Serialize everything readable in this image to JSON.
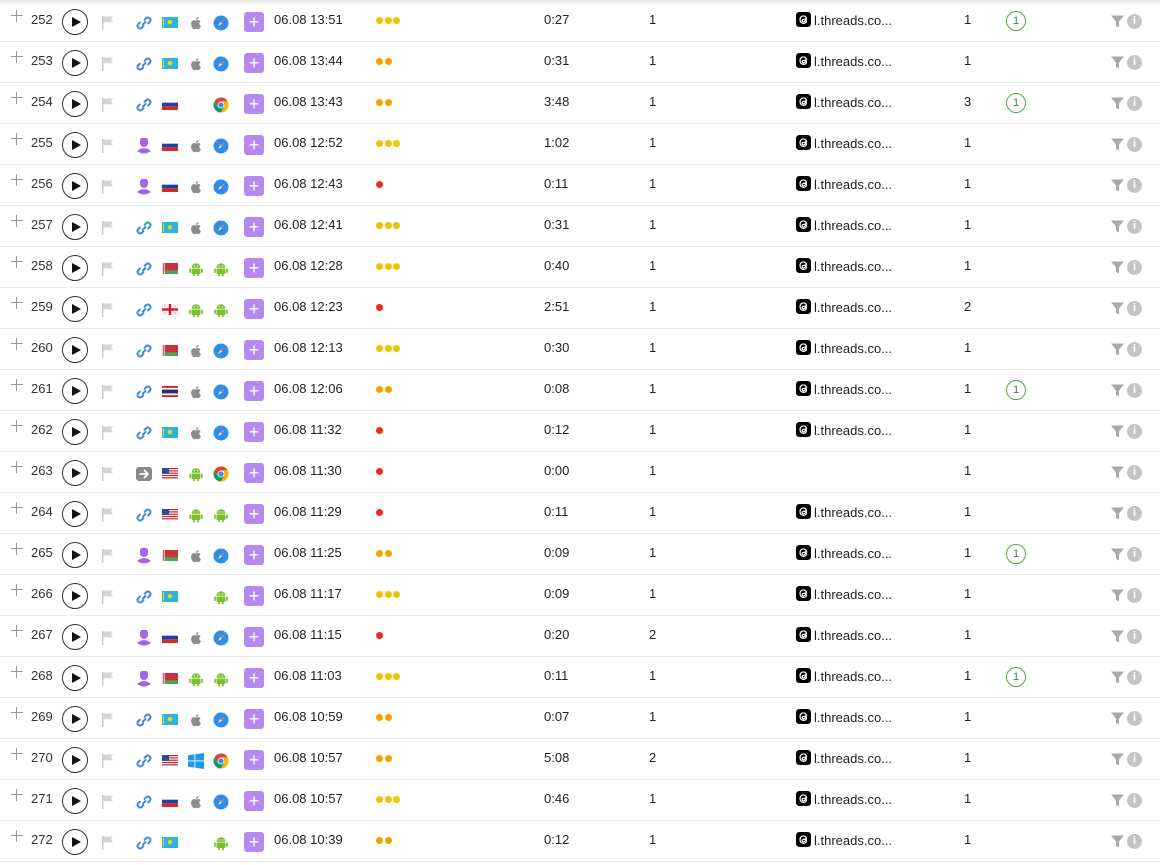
{
  "colors": {
    "accent_purple": "#b58af0",
    "dot_yellow": "#f2c200",
    "dot_orange": "#f5a000",
    "dot_red": "#ee2a1a",
    "badge_green": "#4aaa4a",
    "link_blue": "#3b8bd8"
  },
  "info_icon_text": "i",
  "add_icon_text": "+",
  "rows": [
    {
      "num": "252",
      "source": "link-icon",
      "country": "kz",
      "os": "apple-icon",
      "browser": "safari-icon",
      "date": "06.08 13:51",
      "quality": 3,
      "duration": "0:27",
      "views": "1",
      "referrer": "l.threads.co...",
      "count": "1",
      "badge": "1"
    },
    {
      "num": "253",
      "source": "link-icon",
      "country": "kz",
      "os": "apple-icon",
      "browser": "safari-icon",
      "date": "06.08 13:44",
      "quality": 2,
      "duration": "0:31",
      "views": "1",
      "referrer": "l.threads.co...",
      "count": "1",
      "badge": ""
    },
    {
      "num": "254",
      "source": "link-icon",
      "country": "ru",
      "os": "",
      "browser": "chrome-icon",
      "date": "06.08 13:43",
      "quality": 2,
      "duration": "3:48",
      "views": "1",
      "referrer": "l.threads.co...",
      "count": "3",
      "badge": "1"
    },
    {
      "num": "255",
      "source": "user-icon",
      "country": "ru",
      "os": "apple-icon",
      "browser": "safari-icon",
      "date": "06.08 12:52",
      "quality": 3,
      "duration": "1:02",
      "views": "1",
      "referrer": "l.threads.co...",
      "count": "1",
      "badge": ""
    },
    {
      "num": "256",
      "source": "user-icon",
      "country": "ru",
      "os": "apple-icon",
      "browser": "safari-icon",
      "date": "06.08 12:43",
      "quality": 1,
      "duration": "0:11",
      "views": "1",
      "referrer": "l.threads.co...",
      "count": "1",
      "badge": ""
    },
    {
      "num": "257",
      "source": "link-icon",
      "country": "kz",
      "os": "apple-icon",
      "browser": "safari-icon",
      "date": "06.08 12:41",
      "quality": 3,
      "duration": "0:31",
      "views": "1",
      "referrer": "l.threads.co...",
      "count": "1",
      "badge": ""
    },
    {
      "num": "258",
      "source": "link-icon",
      "country": "by",
      "os": "android-icon",
      "browser": "android-icon",
      "date": "06.08 12:28",
      "quality": 3,
      "duration": "0:40",
      "views": "1",
      "referrer": "l.threads.co...",
      "count": "1",
      "badge": ""
    },
    {
      "num": "259",
      "source": "link-icon",
      "country": "ge",
      "os": "android-icon",
      "browser": "android-icon",
      "date": "06.08 12:23",
      "quality": 1,
      "duration": "2:51",
      "views": "1",
      "referrer": "l.threads.co...",
      "count": "2",
      "badge": ""
    },
    {
      "num": "260",
      "source": "link-icon",
      "country": "by",
      "os": "apple-icon",
      "browser": "safari-icon",
      "date": "06.08 12:13",
      "quality": 3,
      "duration": "0:30",
      "views": "1",
      "referrer": "l.threads.co...",
      "count": "1",
      "badge": ""
    },
    {
      "num": "261",
      "source": "link-icon",
      "country": "th",
      "os": "apple-icon",
      "browser": "safari-icon",
      "date": "06.08 12:06",
      "quality": 2,
      "duration": "0:08",
      "views": "1",
      "referrer": "l.threads.co...",
      "count": "1",
      "badge": "1"
    },
    {
      "num": "262",
      "source": "link-icon",
      "country": "kz",
      "os": "apple-icon",
      "browser": "safari-icon",
      "date": "06.08 11:32",
      "quality": 1,
      "duration": "0:12",
      "views": "1",
      "referrer": "l.threads.co...",
      "count": "1",
      "badge": ""
    },
    {
      "num": "263",
      "source": "arrow-icon",
      "country": "us",
      "os": "android-icon",
      "browser": "chrome-icon",
      "date": "06.08 11:30",
      "quality": 1,
      "duration": "0:00",
      "views": "1",
      "referrer": "",
      "count": "1",
      "badge": ""
    },
    {
      "num": "264",
      "source": "link-icon",
      "country": "us",
      "os": "android-icon",
      "browser": "android-icon",
      "date": "06.08 11:29",
      "quality": 1,
      "duration": "0:11",
      "views": "1",
      "referrer": "l.threads.co...",
      "count": "1",
      "badge": ""
    },
    {
      "num": "265",
      "source": "user-icon",
      "country": "by",
      "os": "apple-icon",
      "browser": "safari-icon",
      "date": "06.08 11:25",
      "quality": 2,
      "duration": "0:09",
      "views": "1",
      "referrer": "l.threads.co...",
      "count": "1",
      "badge": "1"
    },
    {
      "num": "266",
      "source": "link-icon",
      "country": "kz",
      "os": "",
      "browser": "android-icon",
      "date": "06.08 11:17",
      "quality": 3,
      "duration": "0:09",
      "views": "1",
      "referrer": "l.threads.co...",
      "count": "1",
      "badge": ""
    },
    {
      "num": "267",
      "source": "user-icon",
      "country": "ru",
      "os": "apple-icon",
      "browser": "safari-icon",
      "date": "06.08 11:15",
      "quality": 1,
      "duration": "0:20",
      "views": "2",
      "referrer": "l.threads.co...",
      "count": "1",
      "badge": ""
    },
    {
      "num": "268",
      "source": "user-icon",
      "country": "by",
      "os": "android-icon",
      "browser": "android-icon",
      "date": "06.08 11:03",
      "quality": 3,
      "duration": "0:11",
      "views": "1",
      "referrer": "l.threads.co...",
      "count": "1",
      "badge": "1"
    },
    {
      "num": "269",
      "source": "link-icon",
      "country": "kz",
      "os": "apple-icon",
      "browser": "safari-icon",
      "date": "06.08 10:59",
      "quality": 2,
      "duration": "0:07",
      "views": "1",
      "referrer": "l.threads.co...",
      "count": "1",
      "badge": ""
    },
    {
      "num": "270",
      "source": "link-icon",
      "country": "us",
      "os": "windows-icon",
      "browser": "chrome-icon",
      "date": "06.08 10:57",
      "quality": 2,
      "duration": "5:08",
      "views": "2",
      "referrer": "l.threads.co...",
      "count": "1",
      "badge": ""
    },
    {
      "num": "271",
      "source": "link-icon",
      "country": "ru",
      "os": "apple-icon",
      "browser": "safari-icon",
      "date": "06.08 10:57",
      "quality": 3,
      "duration": "0:46",
      "views": "1",
      "referrer": "l.threads.co...",
      "count": "1",
      "badge": ""
    },
    {
      "num": "272",
      "source": "link-icon",
      "country": "kz",
      "os": "",
      "browser": "android-icon",
      "date": "06.08 10:39",
      "quality": 2,
      "duration": "0:12",
      "views": "1",
      "referrer": "l.threads.co...",
      "count": "1",
      "badge": ""
    }
  ]
}
